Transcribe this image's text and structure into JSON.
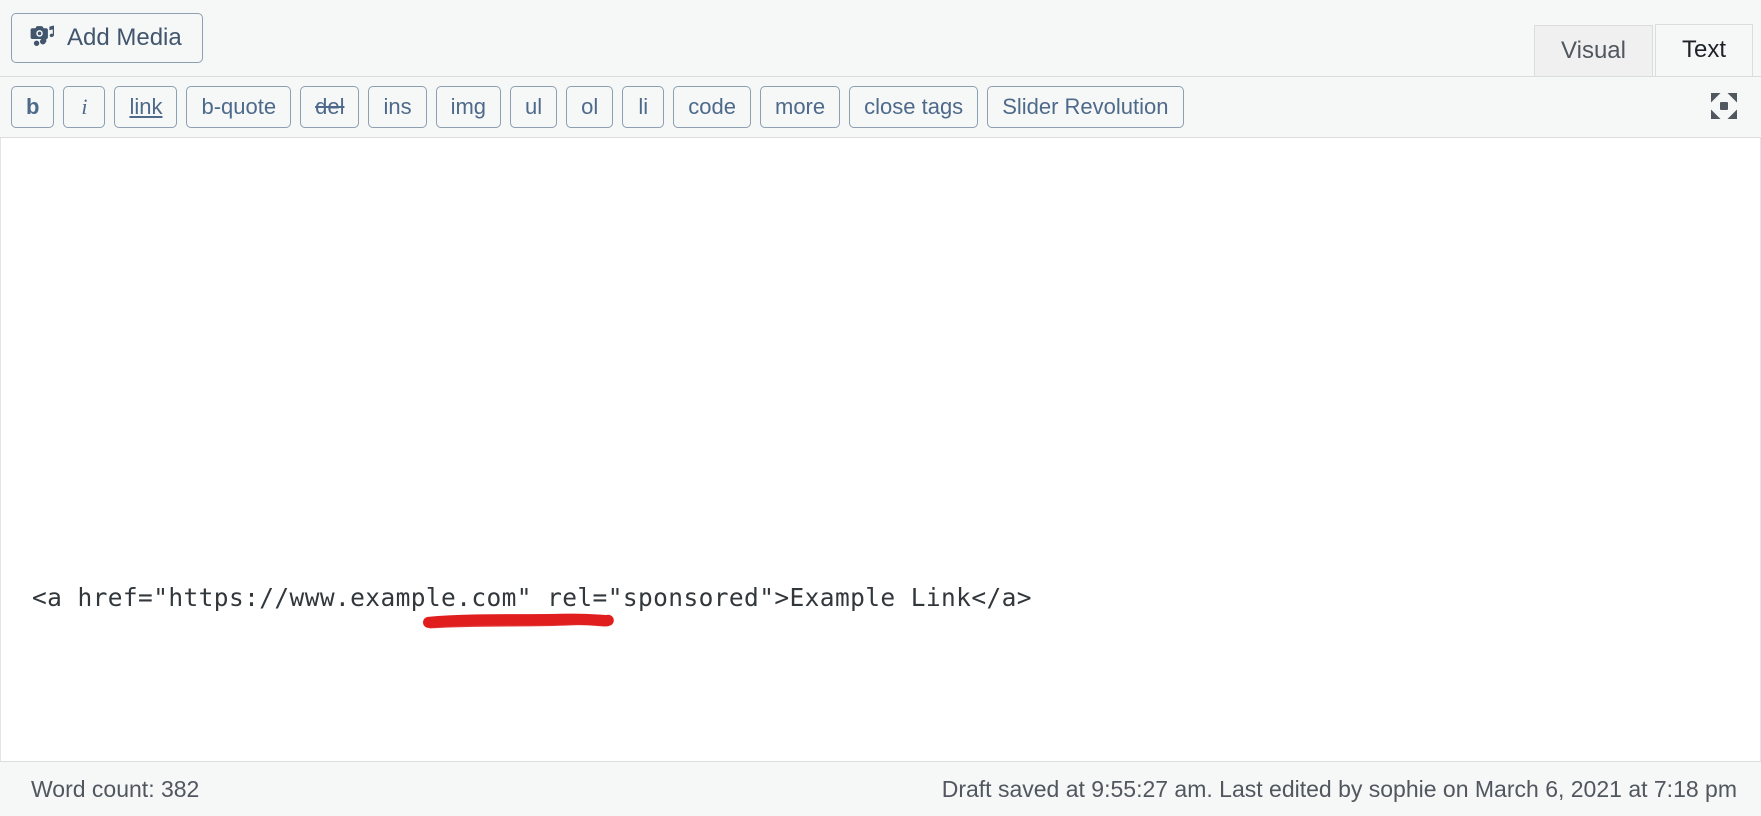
{
  "colors": {
    "toolbar_bg": "#f6f7f7",
    "button_border": "#8d9fb0",
    "button_text": "#4e6a8a",
    "editor_bg": "#ffffff",
    "code_text": "#32373c",
    "annotation_red": "#e01e1e",
    "footer_text": "#50575e",
    "tab_inactive_bg": "#f0f0f1",
    "tab_active_bg": "#f6f7f7"
  },
  "top_bar": {
    "add_media_label": "Add Media",
    "add_media_icon": "camera-music-icon",
    "tabs": [
      {
        "label": "Visual",
        "active": false,
        "name": "tab-visual"
      },
      {
        "label": "Text",
        "active": true,
        "name": "tab-text"
      }
    ]
  },
  "format_toolbar": {
    "fullscreen_icon": "fullscreen-expand-icon",
    "buttons": [
      {
        "label": "b",
        "style": "bold",
        "name": "qt-button-bold"
      },
      {
        "label": "i",
        "style": "italic",
        "name": "qt-button-italic"
      },
      {
        "label": "link",
        "style": "link",
        "name": "qt-button-link"
      },
      {
        "label": "b-quote",
        "style": "plain",
        "name": "qt-button-blockquote"
      },
      {
        "label": "del",
        "style": "del",
        "name": "qt-button-del"
      },
      {
        "label": "ins",
        "style": "plain",
        "name": "qt-button-ins"
      },
      {
        "label": "img",
        "style": "plain",
        "name": "qt-button-img"
      },
      {
        "label": "ul",
        "style": "plain",
        "name": "qt-button-ul"
      },
      {
        "label": "ol",
        "style": "plain",
        "name": "qt-button-ol"
      },
      {
        "label": "li",
        "style": "plain",
        "name": "qt-button-li"
      },
      {
        "label": "code",
        "style": "plain",
        "name": "qt-button-code"
      },
      {
        "label": "more",
        "style": "plain",
        "name": "qt-button-more"
      },
      {
        "label": "close tags",
        "style": "plain",
        "name": "qt-button-close-tags"
      },
      {
        "label": "Slider Revolution",
        "style": "plain",
        "name": "qt-button-slider-revolution"
      }
    ]
  },
  "editor": {
    "content": "<a href=\"https://www.example.com\" rel=\"sponsored\">Example Link</a>",
    "annotation": {
      "type": "hand-drawn-underline",
      "color": "#e01e1e",
      "target_text": "rel=\"sponsored\""
    }
  },
  "footer": {
    "word_count_label": "Word count: 382",
    "autosave_label": "Draft saved at 9:55:27 am. Last edited by sophie on March 6, 2021 at 7:18 pm"
  }
}
